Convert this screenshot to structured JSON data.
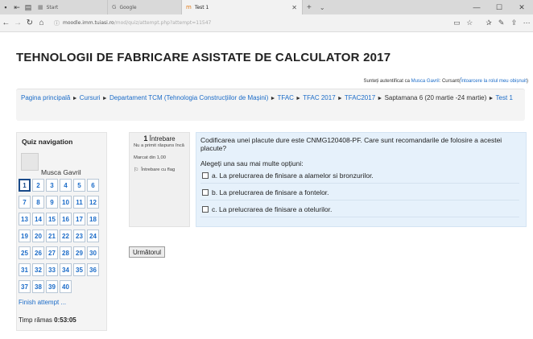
{
  "browser": {
    "tabs": [
      {
        "label": "Start",
        "icon": "start-page-icon"
      },
      {
        "label": "Google",
        "icon": "google-icon"
      },
      {
        "label": "Test 1",
        "icon": "moodle-icon"
      }
    ],
    "url": {
      "host": "moodle.imm.tuiasi.ro",
      "path": "/mod/quiz/attempt.php?attempt=11547"
    }
  },
  "page": {
    "title": "TEHNOLOGII DE FABRICARE ASISTATE DE CALCULATOR 2017",
    "login": {
      "prefix": "Sunteți autentificat ca ",
      "user": "Musca Gavril",
      "role": ": Cursant(",
      "link": "Întoarcere la rolul meu obișnuit",
      "suffix": ")"
    },
    "breadcrumb": [
      "Pagina principală",
      "Cursuri",
      "Departament TCM (Tehnologia Construcțiilor de Mașini)",
      "TFAC",
      "TFAC 2017",
      "TFAC2017",
      "Saptamana 6 (20 martie -24 martie)",
      "Test 1"
    ],
    "breadcrumb_sep": "►"
  },
  "quiz_nav": {
    "title": "Quiz navigation",
    "user": "Musca Gavril",
    "questions": [
      "1",
      "2",
      "3",
      "4",
      "5",
      "6",
      "7",
      "8",
      "9",
      "10",
      "11",
      "12",
      "13",
      "14",
      "15",
      "16",
      "17",
      "18",
      "19",
      "20",
      "21",
      "22",
      "23",
      "24",
      "25",
      "26",
      "27",
      "28",
      "29",
      "30",
      "31",
      "32",
      "33",
      "34",
      "35",
      "36",
      "37",
      "38",
      "39",
      "40"
    ],
    "current": "1",
    "finish": "Finish attempt ...",
    "timer_label": "Timp rămas ",
    "timer_value": "0:53:05"
  },
  "question": {
    "number": "1",
    "label": "Întrebare",
    "status": "Nu a primit răspuns încă",
    "mark": "Marcat din 1,00",
    "flag": "Întrebare cu flag",
    "text": "Codificarea unei placute dure este CNMG120408-PF. Care sunt recomandarile de folosire a acestei placute?",
    "prompt": "Alegeți una sau mai multe opțiuni:",
    "options": [
      "a. La prelucrarea de finisare a alamelor si bronzurilor.",
      "b. La prelucrarea de finisare a fontelor.",
      "c. La prelucrarea de finisare a otelurilor."
    ]
  },
  "next_button": "Următorul"
}
